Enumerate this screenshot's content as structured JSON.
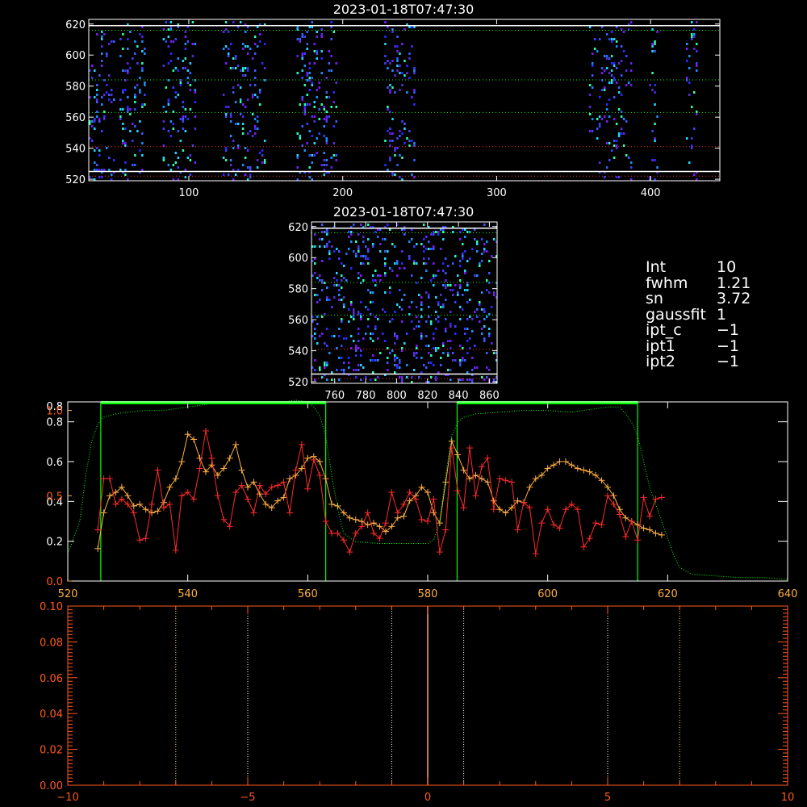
{
  "colors": {
    "background": "#000000",
    "axes": "#ffffff",
    "spectrum_red": "#ff2a2a",
    "spectrum_orange": "#ffb040",
    "profile_green": "#00ff00",
    "bottom_axes": "#ff5a1e",
    "bottom_vline": "#ffb030"
  },
  "panels": {
    "top": {
      "title": "2023-01-18T07:47:30",
      "xlim": [
        35,
        445
      ],
      "ylim": [
        519,
        623
      ],
      "xticks": [
        100,
        200,
        300,
        400
      ],
      "yticks": [
        520,
        540,
        560,
        580,
        600,
        620
      ],
      "white_hlines": [
        619,
        525
      ],
      "dotted_hlines": [
        {
          "y": 616,
          "color": "#00ff00"
        },
        {
          "y": 584,
          "color": "#00ff00"
        },
        {
          "y": 563,
          "color": "#00ff00"
        },
        {
          "y": 541,
          "color": "#ff2a2a"
        },
        {
          "y": 522,
          "color": "#ff2a2a"
        }
      ],
      "pixel_bands": [
        [
          35,
          52
        ],
        [
          55,
          72
        ],
        [
          83,
          105
        ],
        [
          122,
          149
        ],
        [
          170,
          196
        ],
        [
          227,
          247
        ],
        [
          360,
          388
        ],
        [
          399,
          404
        ],
        [
          423,
          430
        ]
      ]
    },
    "middle": {
      "title": "2023-01-18T07:47:30",
      "xlim": [
        745,
        865
      ],
      "ylim": [
        519,
        623
      ],
      "xticks": [
        760,
        780,
        800,
        820,
        840,
        860
      ],
      "yticks": [
        520,
        540,
        560,
        580,
        600,
        620
      ],
      "white_hlines": [
        619,
        525
      ],
      "dotted_hlines": [
        {
          "y": 616,
          "color": "#00ff00"
        },
        {
          "y": 584,
          "color": "#00ff00"
        },
        {
          "y": 563,
          "color": "#00ff00"
        },
        {
          "y": 541,
          "color": "#ff2a2a"
        },
        {
          "y": 522,
          "color": "#ff2a2a"
        }
      ]
    },
    "params": [
      {
        "name": "Int",
        "value": "10"
      },
      {
        "name": "fwhm",
        "value": "1.21"
      },
      {
        "name": "sn",
        "value": "3.72"
      },
      {
        "name": "gaussfit",
        "value": "1"
      },
      {
        "name": "ipt_c",
        "value": "-1"
      },
      {
        "name": "ipt1",
        "value": "-1"
      },
      {
        "name": "ipt2",
        "value": "-1"
      }
    ]
  },
  "chart_data": [
    {
      "type": "line",
      "xlim": [
        520,
        640
      ],
      "xticks": [
        520,
        540,
        560,
        580,
        600,
        620,
        640
      ],
      "left_axis_orange": {
        "ylim": [
          0,
          1.05
        ],
        "ticks": [
          "0.0",
          "0.5",
          "1.0"
        ],
        "tick_values": [
          0,
          0.5,
          1.0
        ]
      },
      "left_axis_white": {
        "ylim": [
          0,
          0.9
        ],
        "ticks": [
          "0.2",
          "0.4",
          "0.6",
          "0.8"
        ],
        "tick_values": [
          0.2,
          0.4,
          0.6,
          0.8
        ],
        "top_label": "0.8"
      },
      "right_axis_ticks": [
        0.2,
        0.4,
        0.6,
        0.8
      ],
      "green_windows": [
        [
          525.5,
          563
        ],
        [
          584.9,
          615
        ]
      ],
      "series": [
        {
          "color": "#ffb040",
          "x": [
            525,
            526,
            527,
            528,
            529,
            530,
            531,
            532,
            533,
            534,
            535,
            536,
            537,
            538,
            539,
            540,
            541,
            542,
            543,
            544,
            545,
            546,
            547,
            548,
            549,
            550,
            551,
            552,
            553,
            554,
            555,
            556,
            557,
            558,
            559,
            560,
            561,
            562,
            563,
            564,
            565,
            566,
            567,
            568,
            569,
            570,
            571,
            572,
            573,
            574,
            575,
            576,
            577,
            578,
            579,
            580,
            581,
            582,
            583,
            584,
            585,
            586,
            587,
            588,
            589,
            590,
            591,
            592,
            593,
            594,
            595,
            596,
            597,
            598,
            599,
            600,
            601,
            602,
            603,
            604,
            605,
            606,
            607,
            608,
            609,
            610,
            611,
            612,
            613,
            614,
            615,
            616,
            617,
            618,
            619
          ],
          "y": [
            0.19,
            0.4,
            0.5,
            0.52,
            0.55,
            0.5,
            0.44,
            0.45,
            0.42,
            0.4,
            0.41,
            0.46,
            0.55,
            0.6,
            0.7,
            0.86,
            0.83,
            0.72,
            0.64,
            0.68,
            0.62,
            0.66,
            0.72,
            0.8,
            0.65,
            0.55,
            0.58,
            0.51,
            0.45,
            0.43,
            0.47,
            0.49,
            0.6,
            0.62,
            0.66,
            0.72,
            0.73,
            0.7,
            0.6,
            0.45,
            0.44,
            0.4,
            0.37,
            0.36,
            0.35,
            0.33,
            0.34,
            0.32,
            0.29,
            0.32,
            0.37,
            0.38,
            0.47,
            0.5,
            0.55,
            0.52,
            0.4,
            0.34,
            0.58,
            0.82,
            0.74,
            0.65,
            0.6,
            0.62,
            0.6,
            0.58,
            0.47,
            0.42,
            0.4,
            0.43,
            0.47,
            0.46,
            0.55,
            0.6,
            0.62,
            0.66,
            0.68,
            0.7,
            0.7,
            0.68,
            0.66,
            0.65,
            0.64,
            0.62,
            0.59,
            0.55,
            0.5,
            0.42,
            0.37,
            0.35,
            0.33,
            0.31,
            0.3,
            0.28,
            0.27
          ]
        },
        {
          "color": "#ff2a2a",
          "x": [
            525,
            526,
            527,
            528,
            529,
            530,
            531,
            532,
            533,
            534,
            535,
            536,
            537,
            538,
            539,
            540,
            541,
            542,
            543,
            544,
            545,
            546,
            547,
            548,
            549,
            550,
            551,
            552,
            553,
            554,
            555,
            556,
            557,
            558,
            559,
            560,
            561,
            562,
            563,
            564,
            565,
            566,
            567,
            568,
            569,
            570,
            571,
            572,
            573,
            574,
            575,
            576,
            577,
            578,
            579,
            580,
            581,
            582,
            583,
            584,
            585,
            586,
            587,
            588,
            589,
            590,
            591,
            592,
            593,
            594,
            595,
            596,
            597,
            598,
            599,
            600,
            601,
            602,
            603,
            604,
            605,
            606,
            607,
            608,
            609,
            610,
            611,
            612,
            613,
            614,
            615,
            616,
            617,
            618,
            619
          ],
          "y": [
            0.3,
            0.6,
            0.6,
            0.45,
            0.48,
            0.45,
            0.4,
            0.24,
            0.25,
            0.45,
            0.65,
            0.43,
            0.45,
            0.18,
            0.5,
            0.52,
            0.48,
            0.66,
            0.88,
            0.72,
            0.5,
            0.36,
            0.32,
            0.52,
            0.56,
            0.48,
            0.4,
            0.56,
            0.51,
            0.55,
            0.56,
            0.58,
            0.4,
            0.65,
            0.8,
            0.54,
            0.71,
            0.62,
            0.35,
            0.28,
            0.28,
            0.24,
            0.17,
            0.28,
            0.32,
            0.4,
            0.28,
            0.25,
            0.34,
            0.52,
            0.4,
            0.45,
            0.52,
            0.48,
            0.36,
            0.35,
            0.48,
            0.17,
            0.3,
            0.78,
            0.53,
            0.43,
            0.78,
            0.5,
            0.67,
            0.72,
            0.42,
            0.6,
            0.59,
            0.58,
            0.3,
            0.46,
            0.43,
            0.16,
            0.34,
            0.42,
            0.33,
            0.31,
            0.42,
            0.45,
            0.42,
            0.2,
            0.25,
            0.34,
            0.33,
            0.5,
            0.45,
            0.39,
            0.26,
            0.35,
            0.24,
            0.49,
            0.38,
            0.48,
            0.49
          ]
        },
        {
          "color": "#00ff00",
          "style": "dotted",
          "x": [
            520,
            522,
            523,
            524,
            525,
            526,
            528,
            530,
            533,
            536,
            540,
            544,
            548,
            552,
            556,
            558,
            560,
            561,
            562,
            563,
            564,
            565,
            566,
            568,
            572,
            576,
            578,
            580,
            581,
            582,
            583,
            584,
            585,
            586,
            588,
            592,
            596,
            600,
            604,
            608,
            610,
            612,
            613,
            614,
            615,
            616,
            617,
            618,
            619,
            620,
            621,
            622,
            624,
            628,
            632,
            636,
            640
          ],
          "y": [
            0.16,
            0.35,
            0.62,
            0.82,
            0.92,
            0.96,
            0.98,
            0.99,
            1.0,
            1.0,
            1.02,
            1.04,
            1.05,
            1.05,
            1.05,
            1.06,
            1.05,
            1.02,
            0.97,
            0.85,
            0.62,
            0.42,
            0.28,
            0.23,
            0.22,
            0.22,
            0.22,
            0.22,
            0.24,
            0.35,
            0.62,
            0.85,
            0.93,
            0.96,
            0.98,
            0.99,
            1.0,
            1.0,
            0.99,
            1.01,
            1.02,
            1.02,
            0.98,
            0.93,
            0.85,
            0.7,
            0.55,
            0.45,
            0.35,
            0.25,
            0.15,
            0.08,
            0.04,
            0.03,
            0.02,
            0.02,
            0.01
          ]
        }
      ]
    },
    {
      "type": "line",
      "xlim": [
        -10,
        10
      ],
      "ylim": [
        0,
        0.1
      ],
      "xticks": [
        -10,
        -5,
        0,
        5,
        10
      ],
      "yticks": [
        "0.00",
        "0.02",
        "0.04",
        "0.06",
        "0.08",
        "0.10"
      ],
      "ytick_values": [
        0,
        0.02,
        0.04,
        0.06,
        0.08,
        0.1
      ],
      "vline_solid": 0,
      "vlines_dotted_yellow": [
        -7,
        7
      ],
      "vlines_dotted_white": [
        -5,
        -1,
        1,
        5
      ]
    }
  ]
}
